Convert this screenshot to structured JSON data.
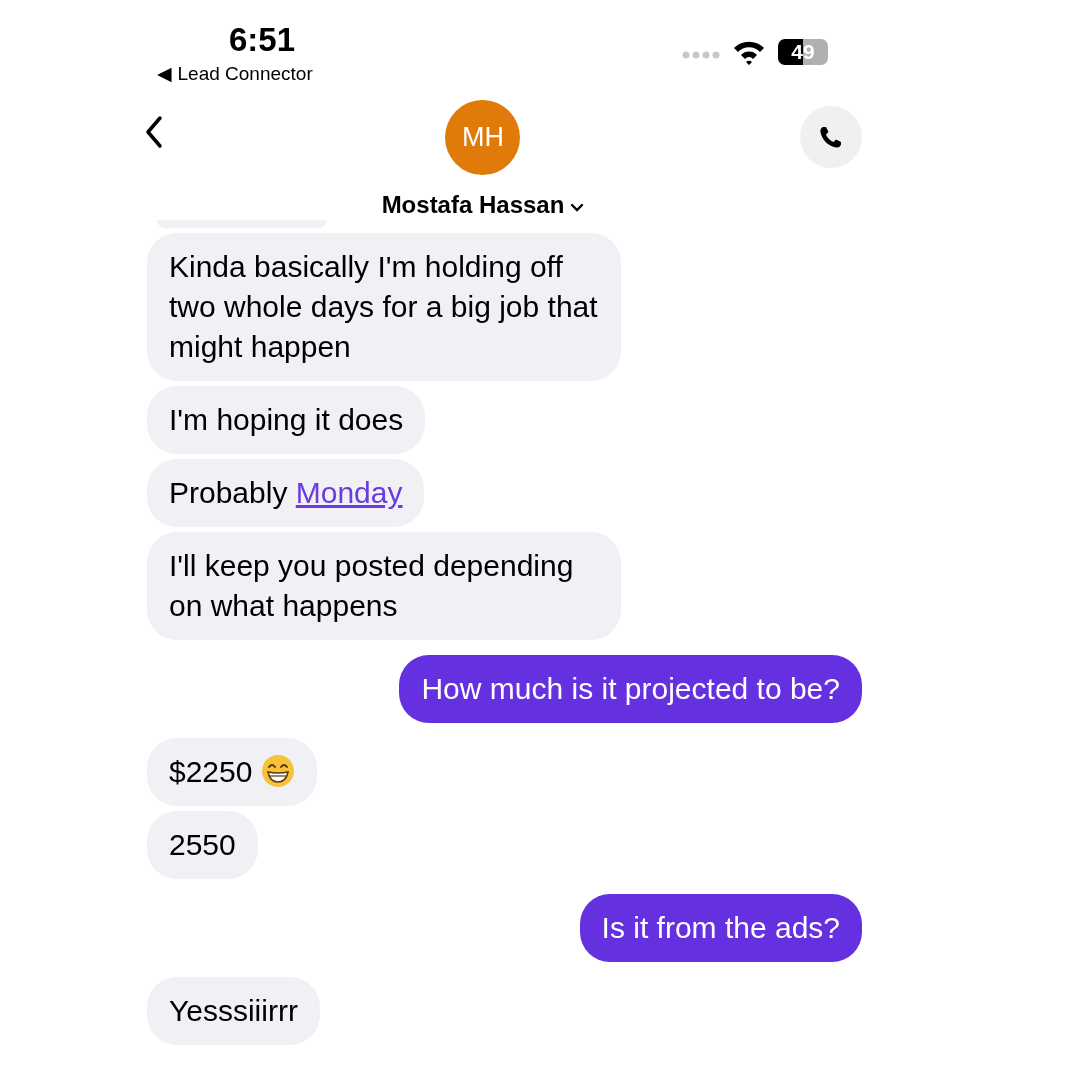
{
  "status_bar": {
    "time": "6:51",
    "back_app": "◀ Lead Connector",
    "battery": "49"
  },
  "header": {
    "avatar_initials": "MH",
    "name": "Mostafa Hassan"
  },
  "messages": [
    {
      "kind": "clipped",
      "outgoing": false
    },
    {
      "kind": "message",
      "outgoing": false,
      "parts": [
        {
          "kind": "text",
          "text": "Kinda basically I'm holding off two whole days for a big job that might happen"
        }
      ]
    },
    {
      "kind": "message",
      "outgoing": false,
      "parts": [
        {
          "kind": "text",
          "text": "I'm hoping it does"
        }
      ]
    },
    {
      "kind": "message",
      "outgoing": false,
      "parts": [
        {
          "kind": "text",
          "text": "Probably "
        },
        {
          "kind": "link",
          "text": "Monday"
        }
      ]
    },
    {
      "kind": "message",
      "outgoing": false,
      "parts": [
        {
          "kind": "text",
          "text": "I'll keep you posted depending on what happens"
        }
      ]
    },
    {
      "kind": "message",
      "outgoing": true,
      "parts": [
        {
          "kind": "text",
          "text": "How much is it projected to be?"
        }
      ]
    },
    {
      "kind": "message",
      "outgoing": false,
      "parts": [
        {
          "kind": "text",
          "text": "$2250 "
        },
        {
          "kind": "emoji"
        }
      ]
    },
    {
      "kind": "message",
      "outgoing": false,
      "parts": [
        {
          "kind": "text",
          "text": "2550"
        }
      ]
    },
    {
      "kind": "message",
      "outgoing": true,
      "parts": [
        {
          "kind": "text",
          "text": "Is it from the ads?"
        }
      ]
    },
    {
      "kind": "message",
      "outgoing": false,
      "parts": [
        {
          "kind": "text",
          "text": "Yesssiiirrr"
        }
      ]
    }
  ]
}
